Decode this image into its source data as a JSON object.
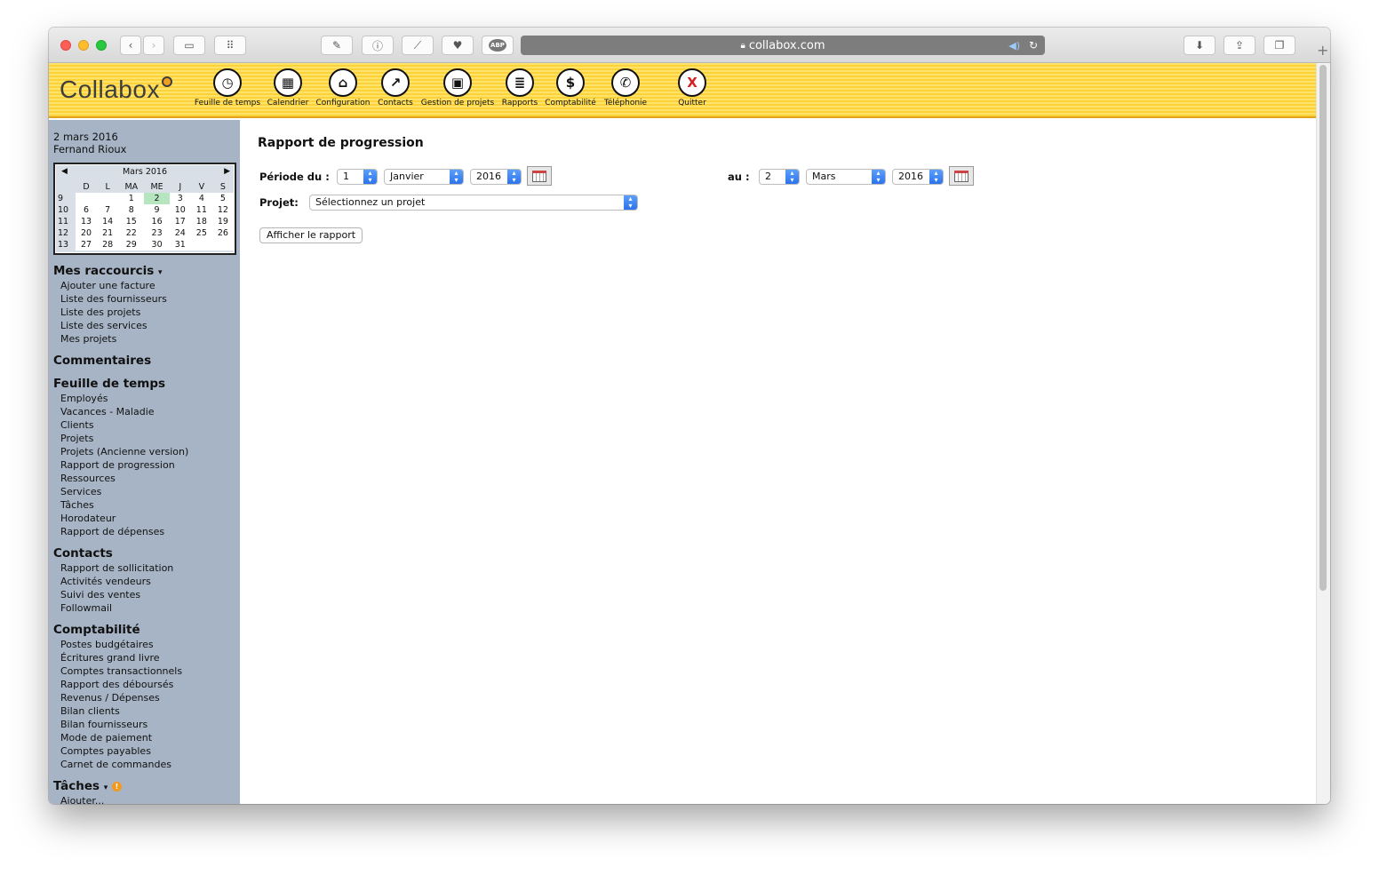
{
  "browser": {
    "url": "collabox.com",
    "icons": [
      "back-icon",
      "forward-icon",
      "sidebar-icon",
      "top-sites-icon",
      "evernote-icon",
      "onepassword-icon",
      "feather-icon",
      "pocket-icon",
      "adblock-icon",
      "speaker-icon",
      "reload-icon",
      "download-icon",
      "share-icon",
      "tabs-icon"
    ],
    "adblock_label": "ABP"
  },
  "app": {
    "logo": "Collabox",
    "nav": [
      {
        "label": "Feuille de temps",
        "icon": "clock-icon"
      },
      {
        "label": "Calendrier",
        "icon": "calendar-icon"
      },
      {
        "label": "Configuration",
        "icon": "configuration-icon"
      },
      {
        "label": "Contacts",
        "icon": "contacts-chart-icon"
      },
      {
        "label": "Gestion de projets",
        "icon": "projects-icon"
      },
      {
        "label": "Rapports",
        "icon": "reports-icon"
      },
      {
        "label": "Comptabilité",
        "icon": "dollar-icon"
      },
      {
        "label": "Téléphonie",
        "icon": "phone-icon"
      },
      {
        "label": "Quitter",
        "icon": "quit-x-icon"
      }
    ],
    "nav_glyphs": [
      "◷",
      "▦",
      "⌂",
      "↗",
      "▣",
      "≣",
      "$",
      "✆",
      "X"
    ]
  },
  "sidebar": {
    "date": "2 mars 2016",
    "user": "Fernand Rioux",
    "calendar": {
      "month": "Mars 2016",
      "weekday_headers": [
        "D",
        "L",
        "MA",
        "ME",
        "J",
        "V",
        "S"
      ],
      "weeks": [
        {
          "num": "9",
          "days": [
            "",
            "",
            "1",
            "2",
            "3",
            "4",
            "5"
          ]
        },
        {
          "num": "10",
          "days": [
            "6",
            "7",
            "8",
            "9",
            "10",
            "11",
            "12"
          ]
        },
        {
          "num": "11",
          "days": [
            "13",
            "14",
            "15",
            "16",
            "17",
            "18",
            "19"
          ]
        },
        {
          "num": "12",
          "days": [
            "20",
            "21",
            "22",
            "23",
            "24",
            "25",
            "26"
          ]
        },
        {
          "num": "13",
          "days": [
            "27",
            "28",
            "29",
            "30",
            "31",
            "",
            ""
          ]
        }
      ],
      "today": "2"
    },
    "sections": [
      {
        "title": "Mes raccourcis",
        "links": [
          "Ajouter une facture",
          "Liste des fournisseurs",
          "Liste des projets",
          "Liste des services",
          "Mes projets"
        ]
      },
      {
        "title": "Commentaires",
        "links": []
      },
      {
        "title": "Feuille de temps",
        "links": [
          "Employés",
          "Vacances - Maladie",
          "Clients",
          "Projets",
          "Projets (Ancienne version)",
          "Rapport de progression",
          "Ressources",
          "Services",
          "Tâches",
          "Horodateur",
          "Rapport de dépenses"
        ]
      },
      {
        "title": "Contacts",
        "links": [
          "Rapport de sollicitation",
          "Activités vendeurs",
          "Suivi des ventes",
          "Followmail"
        ]
      },
      {
        "title": "Comptabilité",
        "links": [
          "Postes budgétaires",
          "Écritures grand livre",
          "Comptes transactionnels",
          "Rapport des déboursés",
          "Revenus / Dépenses",
          "Bilan clients",
          "Bilan fournisseurs",
          "Mode de paiement",
          "Comptes payables",
          "Carnet de commandes"
        ]
      },
      {
        "title": "Tâches",
        "links": [
          "Ajouter..."
        ]
      }
    ]
  },
  "main": {
    "title": "Rapport de progression",
    "period_from_label": "Période du :",
    "period_to_label": "au :",
    "from": {
      "day": "1",
      "month": "Janvier",
      "year": "2016"
    },
    "to": {
      "day": "2",
      "month": "Mars",
      "year": "2016"
    },
    "project_label": "Projet:",
    "project_value": "Sélectionnez un projet",
    "submit_label": "Afficher le rapport"
  }
}
